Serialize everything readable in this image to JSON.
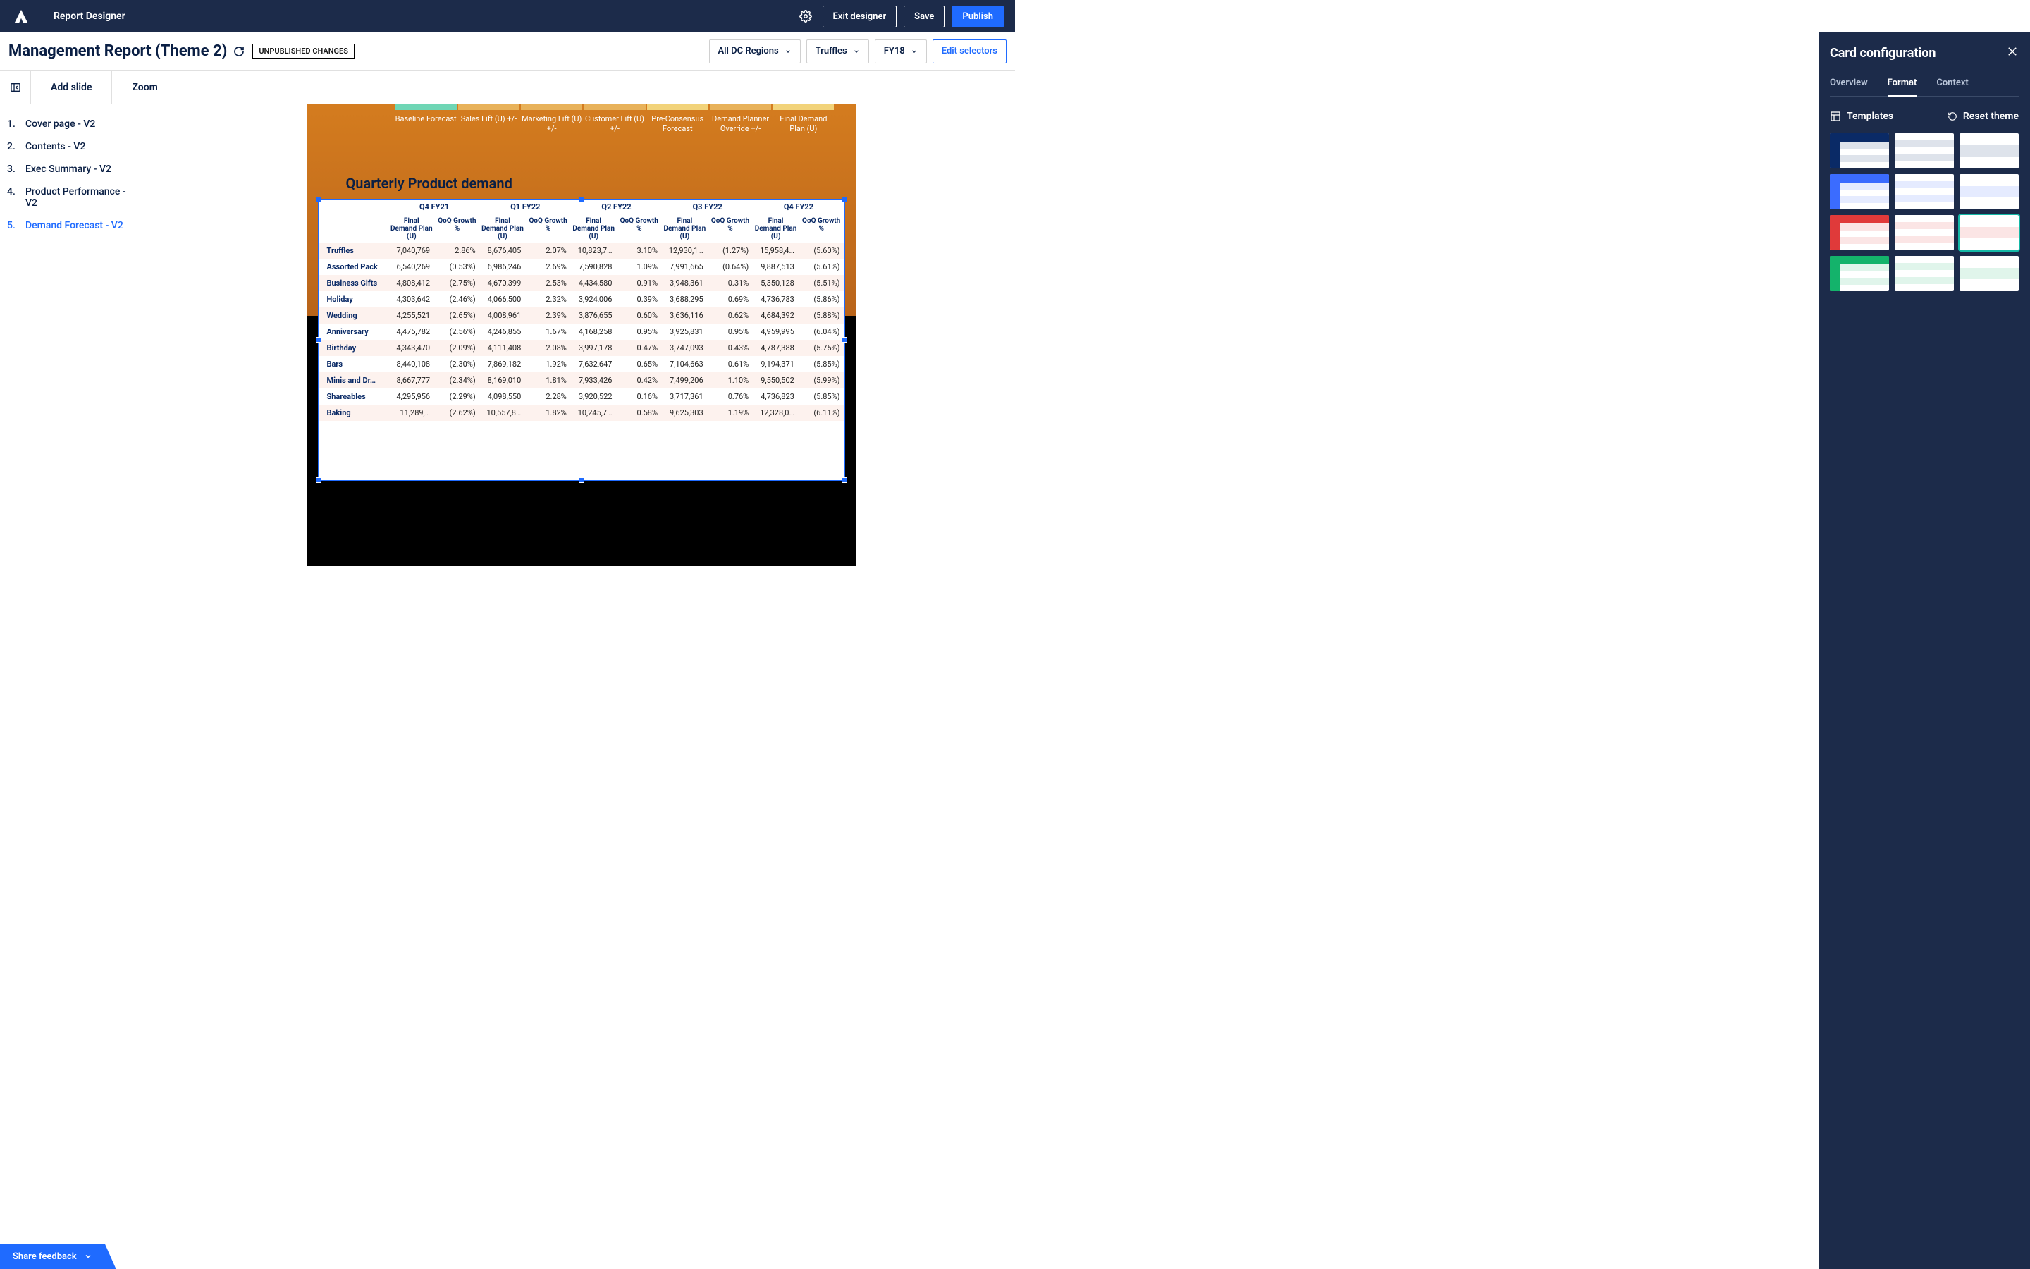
{
  "app": {
    "title": "Report Designer"
  },
  "header": {
    "exit": "Exit designer",
    "save": "Save",
    "publish": "Publish"
  },
  "report": {
    "title": "Management Report (Theme 2)",
    "badge": "UNPUBLISHED CHANGES",
    "selectors": [
      {
        "label": "All DC Regions"
      },
      {
        "label": "Truffles"
      },
      {
        "label": "FY18"
      }
    ],
    "edit_selectors": "Edit selectors"
  },
  "toolbar": {
    "add_slide": "Add slide",
    "zoom": "Zoom"
  },
  "slides": [
    {
      "num": "1.",
      "label": "Cover page - V2"
    },
    {
      "num": "2.",
      "label": "Contents - V2"
    },
    {
      "num": "3.",
      "label": "Exec Summary - V2"
    },
    {
      "num": "4.",
      "label": "Product Performance - V2"
    },
    {
      "num": "5.",
      "label": "Demand Forecast - V2",
      "active": true
    }
  ],
  "waterfall": [
    {
      "label": "Baseline Forecast",
      "color": "#6fd6b5"
    },
    {
      "label": "Sales Lift (U) +/-",
      "color": "#e8b25a"
    },
    {
      "label": "Marketing Lift (U) +/-",
      "color": "#e8b25a"
    },
    {
      "label": "Customer Lift (U) +/-",
      "color": "#e8b25a"
    },
    {
      "label": "Pre-Consensus Forecast",
      "color": "#f2d37a"
    },
    {
      "label": "Demand Planner Override +/-",
      "color": "#e8b25a"
    },
    {
      "label": "Final Demand Plan (U)",
      "color": "#f2d37a"
    }
  ],
  "table": {
    "title": "Quarterly Product demand",
    "periods": [
      "Q4 FY21",
      "Q1 FY22",
      "Q2 FY22",
      "Q3 FY22",
      "Q4 FY22"
    ],
    "sub_a": "Final Demand Plan (U)",
    "sub_b": "QoQ Growth %",
    "rows": [
      {
        "label": "Truffles",
        "v": [
          "7,040,769",
          "2.86%",
          "8,676,405",
          "2.07%",
          "10,823,7…",
          "3.10%",
          "12,930,1…",
          "(1.27%)",
          "15,958,4…",
          "(5.60%)"
        ]
      },
      {
        "label": "Assorted Pack",
        "v": [
          "6,540,269",
          "(0.53%)",
          "6,986,246",
          "2.69%",
          "7,590,828",
          "1.09%",
          "7,991,665",
          "(0.64%)",
          "9,887,513",
          "(5.61%)"
        ]
      },
      {
        "label": "Business Gifts",
        "v": [
          "4,808,412",
          "(2.75%)",
          "4,670,399",
          "2.53%",
          "4,434,580",
          "0.91%",
          "3,948,361",
          "0.31%",
          "5,350,128",
          "(5.51%)"
        ]
      },
      {
        "label": "Holiday",
        "v": [
          "4,303,642",
          "(2.46%)",
          "4,066,500",
          "2.32%",
          "3,924,006",
          "0.39%",
          "3,688,295",
          "0.69%",
          "4,736,783",
          "(5.86%)"
        ]
      },
      {
        "label": "Wedding",
        "v": [
          "4,255,521",
          "(2.65%)",
          "4,008,961",
          "2.39%",
          "3,876,655",
          "0.60%",
          "3,636,116",
          "0.62%",
          "4,684,392",
          "(5.88%)"
        ]
      },
      {
        "label": "Anniversary",
        "v": [
          "4,475,782",
          "(2.56%)",
          "4,246,855",
          "1.67%",
          "4,168,258",
          "0.95%",
          "3,925,831",
          "0.95%",
          "4,959,995",
          "(6.04%)"
        ]
      },
      {
        "label": "Birthday",
        "v": [
          "4,343,470",
          "(2.09%)",
          "4,111,408",
          "2.08%",
          "3,997,178",
          "0.47%",
          "3,747,093",
          "0.43%",
          "4,787,388",
          "(5.75%)"
        ]
      },
      {
        "label": "Bars",
        "v": [
          "8,440,108",
          "(2.30%)",
          "7,869,182",
          "1.92%",
          "7,632,647",
          "0.65%",
          "7,104,663",
          "0.61%",
          "9,194,371",
          "(5.85%)"
        ]
      },
      {
        "label": "Minis and Dr…",
        "v": [
          "8,667,777",
          "(2.34%)",
          "8,169,010",
          "1.81%",
          "7,933,426",
          "0.42%",
          "7,499,206",
          "1.10%",
          "9,550,502",
          "(5.99%)"
        ]
      },
      {
        "label": "Shareables",
        "v": [
          "4,295,956",
          "(2.29%)",
          "4,098,550",
          "2.28%",
          "3,920,522",
          "0.16%",
          "3,717,361",
          "0.76%",
          "4,736,823",
          "(5.85%)"
        ]
      },
      {
        "label": "Baking",
        "v": [
          "11,289,…",
          "(2.62%)",
          "10,557,8…",
          "1.82%",
          "10,245,7…",
          "0.58%",
          "9,625,303",
          "1.19%",
          "12,328,0…",
          "(6.11%)"
        ]
      }
    ]
  },
  "panel": {
    "title": "Card configuration",
    "tabs": [
      "Overview",
      "Format",
      "Context"
    ],
    "active_tab": 1,
    "templates_label": "Templates",
    "reset_label": "Reset theme",
    "theme_colors": [
      "#0a2a66",
      "#3b6cff",
      "#e03a3a",
      "#14b36b"
    ],
    "selected_template_index": 8
  },
  "feedback": "Share feedback"
}
